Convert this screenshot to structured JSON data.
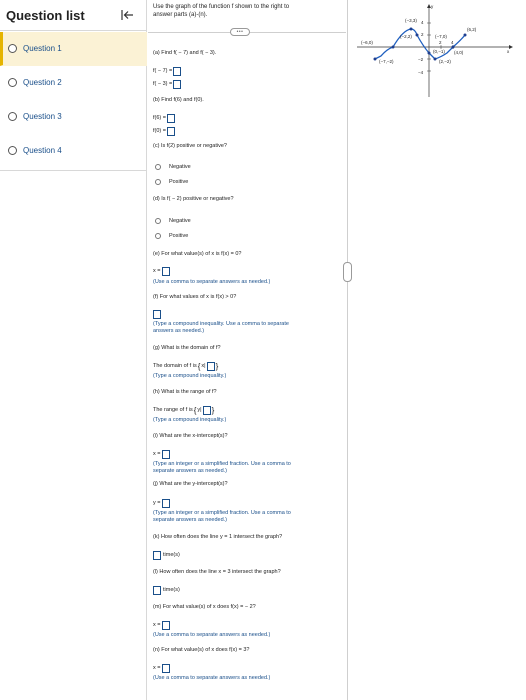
{
  "sidebar": {
    "title": "Question list",
    "items": [
      {
        "label": "Question 1",
        "active": true
      },
      {
        "label": "Question 2",
        "active": false
      },
      {
        "label": "Question 3",
        "active": false
      },
      {
        "label": "Question 4",
        "active": false
      }
    ]
  },
  "intro": {
    "line1": "Use the graph of the function f shown to the right to",
    "line2": "answer parts (a)-(n)."
  },
  "parts": {
    "a": {
      "prompt": "(a) Find f( − 7) and f( − 3).",
      "r1": "f( − 7) =",
      "r2": "f( − 3) ="
    },
    "b": {
      "prompt": "(b) Find f(6) and f(0).",
      "r1": "f(6) =",
      "r2": "f(0) ="
    },
    "c": {
      "prompt": "(c) Is f(2) positive or negative?",
      "opt1": "Negative",
      "opt2": "Positive"
    },
    "d": {
      "prompt": "(d) Is f( − 2) positive or negative?",
      "opt1": "Negative",
      "opt2": "Positive"
    },
    "e": {
      "prompt": "(e) For what value(s) of x is f(x) = 0?",
      "lhs": "x =",
      "hint": "(Use a comma to separate answers as needed.)"
    },
    "f": {
      "prompt": "(f) For what values of x is f(x) > 0?",
      "hint1": "(Type a compound inequality. Use a comma to separate",
      "hint2": "answers as needed.)"
    },
    "g": {
      "prompt": "(g) What is the domain of f?",
      "lhs": "The domain of f is",
      "set": "x|",
      "hint": "(Type a compound inequality.)"
    },
    "h": {
      "prompt": "(h) What is the range of f?",
      "lhs": "The range of f is",
      "set": "y|",
      "hint": "(Type a compound inequality.)"
    },
    "i": {
      "prompt": "(i) What are the x-intercept(s)?",
      "lhs": "x =",
      "hint1": "(Type an integer or a simplified fraction. Use a comma to",
      "hint2": "separate answers as needed.)"
    },
    "j": {
      "prompt": "(j) What are the y-intercept(s)?",
      "lhs": "y =",
      "hint1": "(Type an integer or a simplified fraction. Use a comma to",
      "hint2": "separate answers as needed.)"
    },
    "k": {
      "prompt": "(k) How often does the line y = 1 intersect the graph?",
      "unit": "time(s)"
    },
    "l": {
      "prompt": "(l) How often does the line x = 3 intersect the graph?",
      "unit": "time(s)"
    },
    "m": {
      "prompt": "(m) For what value(s) of x does f(x) = − 2?",
      "lhs": "x =",
      "hint": "(Use a comma to separate answers as needed.)"
    },
    "n": {
      "prompt": "(n) For what value(s) of x does f(x) = 3?",
      "lhs": "x =",
      "hint": "(Use a comma to separate answers as needed.)"
    }
  },
  "graph": {
    "y_axis_label": "y",
    "x_axis_label": "x",
    "ticks": {
      "y4": "4",
      "y2": "2",
      "ym2": "−2",
      "ym4": "−4",
      "x2": "2",
      "x4": "4"
    },
    "points": {
      "p1": "(−6,0)",
      "p2": "(−3,3)",
      "p3": "(−2,2)",
      "p4": "(−7,0)",
      "p5": "(0,−1)",
      "p6": "(4,0)",
      "p7": "(6,2)",
      "p8": "(2,−2)",
      "p9": "(−7,−2)"
    },
    "curve_color": "#1f5fbf"
  }
}
